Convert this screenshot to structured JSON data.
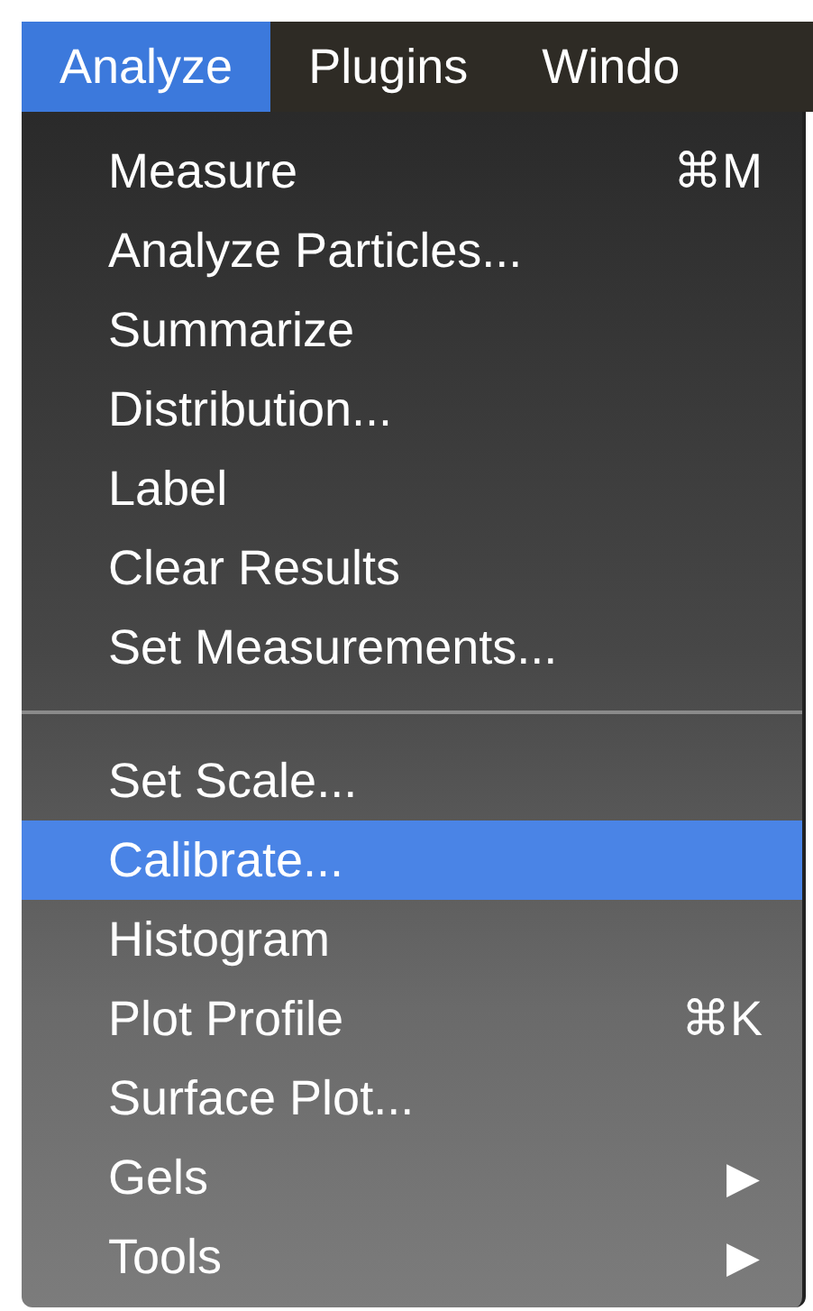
{
  "menu_bar": [
    {
      "label": "Analyze",
      "selected": true
    },
    {
      "label": "Plugins",
      "selected": false
    },
    {
      "label": "Windo",
      "selected": false
    }
  ],
  "menu": [
    {
      "kind": "item",
      "label": "Measure",
      "shortcut": "⌘M",
      "selected": false
    },
    {
      "kind": "item",
      "label": "Analyze Particles...",
      "selected": false
    },
    {
      "kind": "item",
      "label": "Summarize",
      "selected": false
    },
    {
      "kind": "item",
      "label": "Distribution...",
      "selected": false
    },
    {
      "kind": "item",
      "label": "Label",
      "selected": false
    },
    {
      "kind": "item",
      "label": "Clear Results",
      "selected": false
    },
    {
      "kind": "item",
      "label": "Set Measurements...",
      "selected": false
    },
    {
      "kind": "separator"
    },
    {
      "kind": "item",
      "label": "Set Scale...",
      "selected": false
    },
    {
      "kind": "item",
      "label": "Calibrate...",
      "selected": true
    },
    {
      "kind": "item",
      "label": "Histogram",
      "selected": false
    },
    {
      "kind": "item",
      "label": "Plot Profile",
      "shortcut": "⌘K",
      "selected": false
    },
    {
      "kind": "item",
      "label": "Surface Plot...",
      "selected": false
    },
    {
      "kind": "item",
      "label": "Gels",
      "submenu": "▶",
      "selected": false
    },
    {
      "kind": "item",
      "label": "Tools",
      "submenu": "▶",
      "selected": false
    }
  ]
}
